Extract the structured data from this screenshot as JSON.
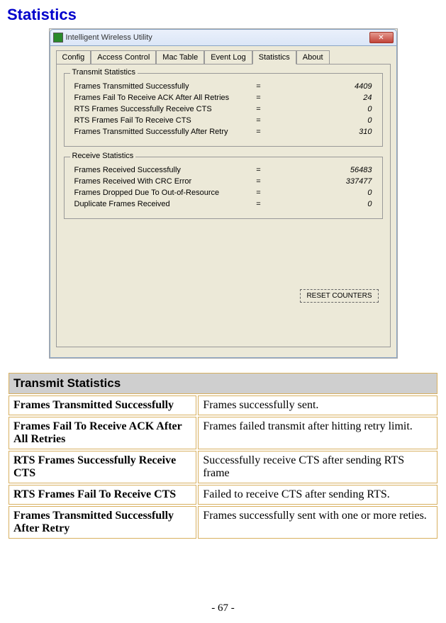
{
  "heading": "Statistics",
  "window": {
    "title": "Intelligent Wireless Utility",
    "close_glyph": "✕",
    "tabs": [
      "Config",
      "Access Control",
      "Mac Table",
      "Event Log",
      "Statistics",
      "About"
    ],
    "active_tab_index": 4,
    "transmit": {
      "legend": "Transmit Statistics",
      "rows": [
        {
          "label": "Frames Transmitted Successfully",
          "eq": "=",
          "val": "4409"
        },
        {
          "label": "Frames Fail To Receive ACK After All Retries",
          "eq": "=",
          "val": "24"
        },
        {
          "label": "RTS Frames Successfully Receive CTS",
          "eq": "=",
          "val": "0"
        },
        {
          "label": "RTS Frames Fail To Receive CTS",
          "eq": "=",
          "val": "0"
        },
        {
          "label": "Frames Transmitted Successfully After Retry",
          "eq": "=",
          "val": "310"
        }
      ]
    },
    "receive": {
      "legend": "Receive Statistics",
      "rows": [
        {
          "label": "Frames Received Successfully",
          "eq": "=",
          "val": "56483"
        },
        {
          "label": "Frames Received With CRC Error",
          "eq": "=",
          "val": "337477"
        },
        {
          "label": "Frames Dropped Due To Out-of-Resource",
          "eq": "=",
          "val": "0"
        },
        {
          "label": "Duplicate Frames Received",
          "eq": "=",
          "val": "0"
        }
      ]
    },
    "reset_button": "RESET COUNTERS"
  },
  "table": {
    "header": "Transmit Statistics",
    "rows": [
      {
        "label": "Frames Transmitted Successfully",
        "desc": "Frames successfully sent."
      },
      {
        "label": "Frames Fail To Receive ACK After All Retries",
        "desc": "Frames failed transmit after hitting retry limit."
      },
      {
        "label": "RTS Frames Successfully Receive CTS",
        "desc": "Successfully receive CTS after sending RTS frame"
      },
      {
        "label": "RTS Frames Fail To Receive CTS",
        "desc": "Failed to receive CTS after sending RTS."
      },
      {
        "label": "Frames Transmitted Successfully After Retry",
        "desc": "Frames successfully sent with one or more reties."
      }
    ]
  },
  "page_number": "- 67 -"
}
